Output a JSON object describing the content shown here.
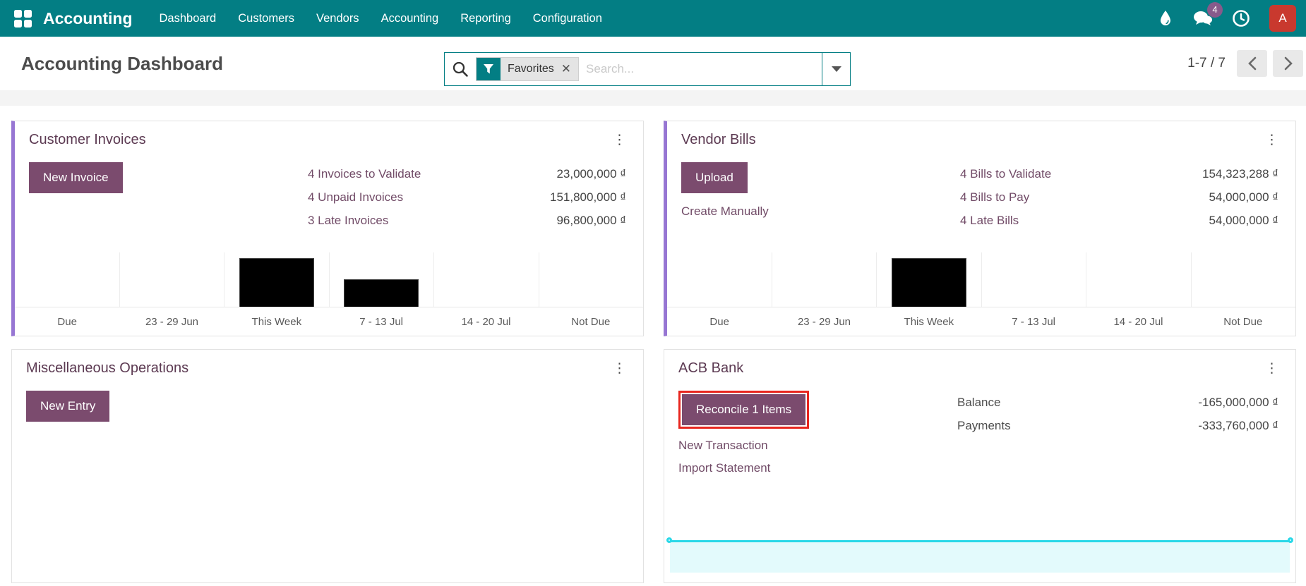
{
  "nav": {
    "app_name": "Accounting",
    "menu": [
      "Dashboard",
      "Customers",
      "Vendors",
      "Accounting",
      "Reporting",
      "Configuration"
    ],
    "activity_badge": "4",
    "avatar_letter": "A"
  },
  "control_panel": {
    "title": "Accounting Dashboard",
    "filter_facet": "Favorites",
    "facet_remove": "✕",
    "search_placeholder": "Search...",
    "pager_text": "1-7 / 7"
  },
  "cards": {
    "customer_invoices": {
      "title": "Customer Invoices",
      "kebab": "⋮",
      "button": "New Invoice",
      "stats": [
        {
          "label": "4 Invoices to Validate",
          "value": "23,000,000 ₫"
        },
        {
          "label": "4 Unpaid Invoices",
          "value": "151,800,000 ₫"
        },
        {
          "label": "3 Late Invoices",
          "value": "96,800,000 ₫"
        }
      ]
    },
    "vendor_bills": {
      "title": "Vendor Bills",
      "kebab": "⋮",
      "button": "Upload",
      "link": "Create Manually",
      "stats": [
        {
          "label": "4 Bills to Validate",
          "value": "154,323,288 ₫"
        },
        {
          "label": "4 Bills to Pay",
          "value": "54,000,000 ₫"
        },
        {
          "label": "4 Late Bills",
          "value": "54,000,000 ₫"
        }
      ]
    },
    "misc_operations": {
      "title": "Miscellaneous Operations",
      "kebab": "⋮",
      "button": "New Entry"
    },
    "acb_bank": {
      "title": "ACB Bank",
      "kebab": "⋮",
      "button": "Reconcile 1 Items",
      "links": [
        "New Transaction",
        "Import Statement"
      ],
      "stats": [
        {
          "label": "Balance",
          "value": "-165,000,000 ₫"
        },
        {
          "label": "Payments",
          "value": "-333,760,000 ₫"
        }
      ]
    }
  },
  "chart_data": [
    {
      "id": "customer_invoices",
      "type": "bar",
      "title": "Customer Invoices due-date graph",
      "categories": [
        "Due",
        "23 - 29 Jun",
        "This Week",
        "7 - 13 Jul",
        "14 - 20 Jul",
        "Not Due"
      ],
      "values": [
        0,
        0,
        69,
        39,
        0,
        0
      ],
      "value_unit": "relative bar height (px), no value axis shown",
      "bar_color": "#000000",
      "grid": true
    },
    {
      "id": "vendor_bills",
      "type": "bar",
      "title": "Vendor Bills due-date graph",
      "categories": [
        "Due",
        "23 - 29 Jun",
        "This Week",
        "7 - 13 Jul",
        "14 - 20 Jul",
        "Not Due"
      ],
      "values": [
        0,
        0,
        69,
        0,
        0,
        0
      ],
      "value_unit": "relative bar height (px), no value axis shown",
      "bar_color": "#000000",
      "grid": true
    },
    {
      "id": "acb_bank",
      "type": "line",
      "title": "ACB Bank balance graph (flat line with selection handles)",
      "values": [
        0,
        0
      ],
      "line_color": "#29d8e8"
    }
  ],
  "colors": {
    "nav_teal": "#037e84",
    "primary_purple": "#7b4b6e",
    "title_purple": "#5c3a52",
    "link_purple": "#714b67",
    "accent_border_purple": "#9776d3",
    "badge_purple": "#875a8b",
    "avatar_red": "#c9392e",
    "highlight_red": "#e8261f",
    "selection_cyan": "#29d8e8",
    "bar_black": "#000000"
  }
}
